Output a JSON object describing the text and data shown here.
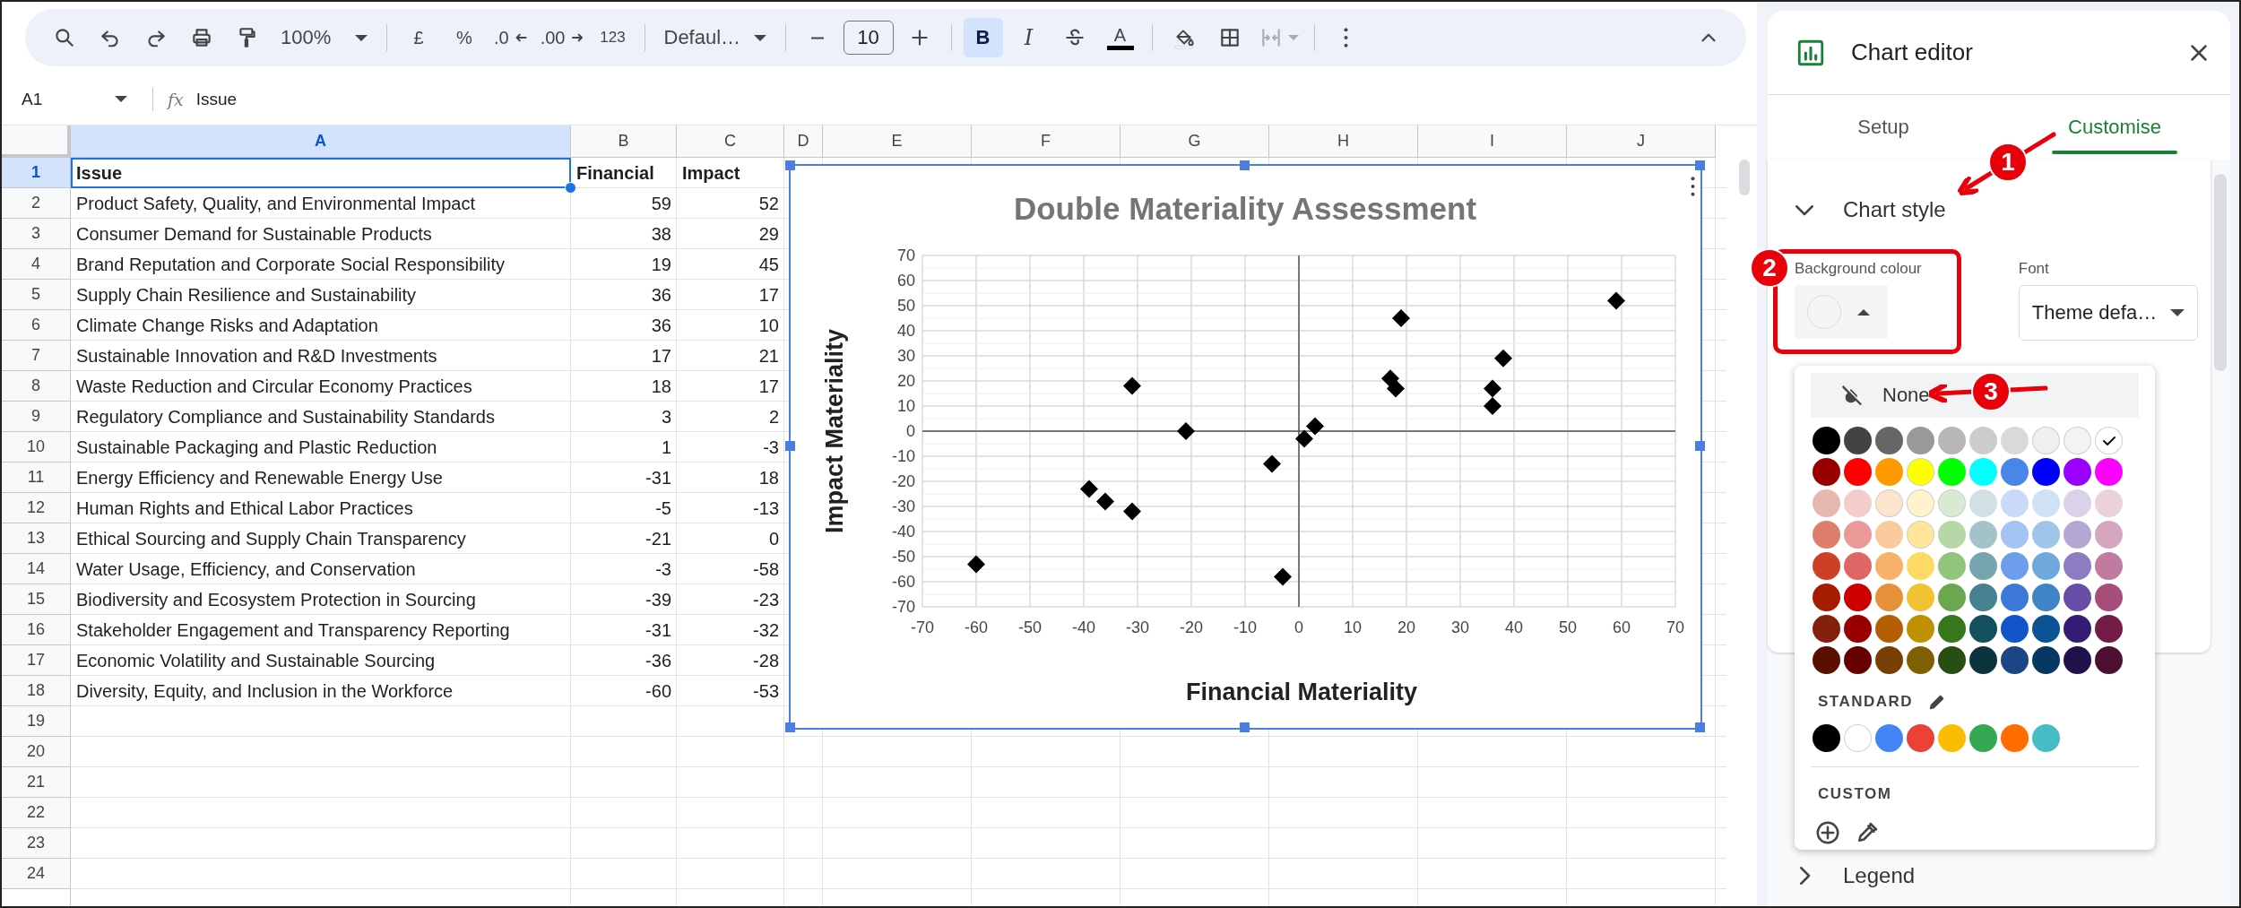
{
  "toolbar": {
    "zoom": "100%",
    "currency": "£",
    "percent": "%",
    "decrease_decimal": ".0",
    "increase_decimal": ".00",
    "number_format": "123",
    "font": "Defaul…",
    "font_size": "10",
    "bold": {
      "label": "B",
      "selected": true
    },
    "italic": {
      "label": "I",
      "selected": false
    },
    "text_colour": "A",
    "merge": {
      "disabled": true
    }
  },
  "formula_bar": {
    "cell": "A1",
    "fx": "fx",
    "value": "Issue"
  },
  "sheet": {
    "columns": [
      {
        "label": "A",
        "selected": true
      },
      {
        "label": "B",
        "selected": false
      },
      {
        "label": "C",
        "selected": false
      },
      {
        "label": "D",
        "selected": false
      },
      {
        "label": "E",
        "selected": false
      },
      {
        "label": "F",
        "selected": false
      },
      {
        "label": "G",
        "selected": false
      },
      {
        "label": "H",
        "selected": false
      },
      {
        "label": "I",
        "selected": false
      },
      {
        "label": "J",
        "selected": false
      }
    ],
    "rows": [
      {
        "number": "1",
        "selected": true,
        "bold": true,
        "cells": [
          "Issue",
          "Financial",
          "Impact"
        ]
      },
      {
        "number": "2",
        "selected": false,
        "bold": false,
        "cells": [
          "Product Safety, Quality, and Environmental Impact",
          "59",
          "52"
        ]
      },
      {
        "number": "3",
        "selected": false,
        "bold": false,
        "cells": [
          "Consumer Demand for Sustainable Products",
          "38",
          "29"
        ]
      },
      {
        "number": "4",
        "selected": false,
        "bold": false,
        "cells": [
          "Brand Reputation and Corporate Social Responsibility",
          "19",
          "45"
        ]
      },
      {
        "number": "5",
        "selected": false,
        "bold": false,
        "cells": [
          "Supply Chain Resilience and Sustainability",
          "36",
          "17"
        ]
      },
      {
        "number": "6",
        "selected": false,
        "bold": false,
        "cells": [
          "Climate Change Risks and Adaptation",
          "36",
          "10"
        ]
      },
      {
        "number": "7",
        "selected": false,
        "bold": false,
        "cells": [
          "Sustainable Innovation and R&D Investments",
          "17",
          "21"
        ]
      },
      {
        "number": "8",
        "selected": false,
        "bold": false,
        "cells": [
          "Waste Reduction and Circular Economy Practices",
          "18",
          "17"
        ]
      },
      {
        "number": "9",
        "selected": false,
        "bold": false,
        "cells": [
          "Regulatory Compliance and Sustainability Standards",
          "3",
          "2"
        ]
      },
      {
        "number": "10",
        "selected": false,
        "bold": false,
        "cells": [
          "Sustainable Packaging and Plastic Reduction",
          "1",
          "-3"
        ]
      },
      {
        "number": "11",
        "selected": false,
        "bold": false,
        "cells": [
          "Energy Efficiency and Renewable Energy Use",
          "-31",
          "18"
        ]
      },
      {
        "number": "12",
        "selected": false,
        "bold": false,
        "cells": [
          "Human Rights and Ethical Labor Practices",
          "-5",
          "-13"
        ]
      },
      {
        "number": "13",
        "selected": false,
        "bold": false,
        "cells": [
          "Ethical Sourcing and Supply Chain Transparency",
          "-21",
          "0"
        ]
      },
      {
        "number": "14",
        "selected": false,
        "bold": false,
        "cells": [
          "Water Usage, Efficiency, and Conservation",
          "-3",
          "-58"
        ]
      },
      {
        "number": "15",
        "selected": false,
        "bold": false,
        "cells": [
          "Biodiversity and Ecosystem Protection in Sourcing",
          "-39",
          "-23"
        ]
      },
      {
        "number": "16",
        "selected": false,
        "bold": false,
        "cells": [
          "Stakeholder Engagement and Transparency Reporting",
          "-31",
          "-32"
        ]
      },
      {
        "number": "17",
        "selected": false,
        "bold": false,
        "cells": [
          "Economic Volatility and Sustainable Sourcing",
          "-36",
          "-28"
        ]
      },
      {
        "number": "18",
        "selected": false,
        "bold": false,
        "cells": [
          "Diversity, Equity, and Inclusion in the Workforce",
          "-60",
          "-53"
        ]
      },
      {
        "number": "19",
        "selected": false
      },
      {
        "number": "20",
        "selected": false
      },
      {
        "number": "21",
        "selected": false
      },
      {
        "number": "22",
        "selected": false
      },
      {
        "number": "23",
        "selected": false
      },
      {
        "number": "24",
        "selected": false
      }
    ],
    "chart": {
      "chart_data": {
        "type": "scatter",
        "title": "Double Materiality Assessment",
        "xlabel": "Financial Materiality",
        "ylabel": "Impact Materiality",
        "x": [
          59,
          38,
          19,
          36,
          36,
          17,
          18,
          3,
          1,
          -31,
          -5,
          -21,
          -3,
          -39,
          -31,
          -36,
          -60
        ],
        "series": [
          {
            "color": "#000000",
            "values": [
              52,
              29,
              45,
              17,
              10,
              21,
              17,
              2,
              -3,
              18,
              -13,
              0,
              -58,
              -23,
              -32,
              -28,
              -53
            ]
          }
        ],
        "xlim": [
          -70,
          70
        ],
        "ylim": [
          -70,
          70
        ],
        "grid": true,
        "xticks": [
          -70,
          -60,
          -50,
          -40,
          -30,
          -20,
          -10,
          0,
          10,
          20,
          30,
          40,
          50,
          60,
          70
        ],
        "yticks": [
          -70,
          -60,
          -50,
          -40,
          -30,
          -20,
          -10,
          0,
          10,
          20,
          30,
          40,
          50,
          60,
          70
        ]
      }
    }
  },
  "chart_editor": {
    "title": "Chart editor",
    "tabs": [
      {
        "label": "Setup",
        "selected": false
      },
      {
        "label": "Customise",
        "selected": true
      }
    ],
    "sections": [
      {
        "title": "Chart style",
        "expanded": true
      },
      {
        "title": "Legend",
        "expanded": false
      }
    ],
    "background_colour": {
      "label": "Background colour"
    },
    "font": {
      "label": "Font",
      "value": "Theme defa…"
    },
    "colour_menu": {
      "none_label": "None",
      "palette": [
        [
          {
            "color": "#000000",
            "selected": false
          },
          {
            "color": "#434343",
            "selected": false
          },
          {
            "color": "#666666",
            "selected": false
          },
          {
            "color": "#999999",
            "selected": false
          },
          {
            "color": "#b7b7b7",
            "selected": false
          },
          {
            "color": "#cccccc",
            "selected": false
          },
          {
            "color": "#d9d9d9",
            "selected": false
          },
          {
            "color": "#efefef",
            "selected": false
          },
          {
            "color": "#f3f3f3",
            "selected": false
          },
          {
            "color": "#ffffff",
            "selected": true
          }
        ],
        [
          {
            "color": "#980000",
            "selected": false
          },
          {
            "color": "#ff0000",
            "selected": false
          },
          {
            "color": "#ff9900",
            "selected": false
          },
          {
            "color": "#ffff00",
            "selected": false
          },
          {
            "color": "#00ff00",
            "selected": false
          },
          {
            "color": "#00ffff",
            "selected": false
          },
          {
            "color": "#4a86e8",
            "selected": false
          },
          {
            "color": "#0000ff",
            "selected": false
          },
          {
            "color": "#9900ff",
            "selected": false
          },
          {
            "color": "#ff00ff",
            "selected": false
          }
        ],
        [
          {
            "color": "#e6b8af",
            "selected": false
          },
          {
            "color": "#f4cccc",
            "selected": false
          },
          {
            "color": "#fce5cd",
            "selected": false
          },
          {
            "color": "#fff2cc",
            "selected": false
          },
          {
            "color": "#d9ead3",
            "selected": false
          },
          {
            "color": "#d0e0e3",
            "selected": false
          },
          {
            "color": "#c9daf8",
            "selected": false
          },
          {
            "color": "#cfe2f3",
            "selected": false
          },
          {
            "color": "#d9d2e9",
            "selected": false
          },
          {
            "color": "#ead1dc",
            "selected": false
          }
        ],
        [
          {
            "color": "#dd7e6b",
            "selected": false
          },
          {
            "color": "#ea9999",
            "selected": false
          },
          {
            "color": "#f9cb9c",
            "selected": false
          },
          {
            "color": "#ffe599",
            "selected": false
          },
          {
            "color": "#b6d7a8",
            "selected": false
          },
          {
            "color": "#a2c4c9",
            "selected": false
          },
          {
            "color": "#a4c2f4",
            "selected": false
          },
          {
            "color": "#9fc5e8",
            "selected": false
          },
          {
            "color": "#b4a7d6",
            "selected": false
          },
          {
            "color": "#d5a6bd",
            "selected": false
          }
        ],
        [
          {
            "color": "#cc4125",
            "selected": false
          },
          {
            "color": "#e06666",
            "selected": false
          },
          {
            "color": "#f6b26b",
            "selected": false
          },
          {
            "color": "#ffd966",
            "selected": false
          },
          {
            "color": "#93c47d",
            "selected": false
          },
          {
            "color": "#76a5af",
            "selected": false
          },
          {
            "color": "#6d9eeb",
            "selected": false
          },
          {
            "color": "#6fa8dc",
            "selected": false
          },
          {
            "color": "#8e7cc3",
            "selected": false
          },
          {
            "color": "#c27ba0",
            "selected": false
          }
        ],
        [
          {
            "color": "#a61c00",
            "selected": false
          },
          {
            "color": "#cc0000",
            "selected": false
          },
          {
            "color": "#e69138",
            "selected": false
          },
          {
            "color": "#f1c232",
            "selected": false
          },
          {
            "color": "#6aa84f",
            "selected": false
          },
          {
            "color": "#45818e",
            "selected": false
          },
          {
            "color": "#3c78d8",
            "selected": false
          },
          {
            "color": "#3d85c6",
            "selected": false
          },
          {
            "color": "#674ea7",
            "selected": false
          },
          {
            "color": "#a64d79",
            "selected": false
          }
        ],
        [
          {
            "color": "#85200c",
            "selected": false
          },
          {
            "color": "#990000",
            "selected": false
          },
          {
            "color": "#b45f06",
            "selected": false
          },
          {
            "color": "#bf9000",
            "selected": false
          },
          {
            "color": "#38761d",
            "selected": false
          },
          {
            "color": "#134f5c",
            "selected": false
          },
          {
            "color": "#1155cc",
            "selected": false
          },
          {
            "color": "#0b5394",
            "selected": false
          },
          {
            "color": "#351c75",
            "selected": false
          },
          {
            "color": "#741b47",
            "selected": false
          }
        ],
        [
          {
            "color": "#5b0f00",
            "selected": false
          },
          {
            "color": "#660000",
            "selected": false
          },
          {
            "color": "#783f04",
            "selected": false
          },
          {
            "color": "#7f6000",
            "selected": false
          },
          {
            "color": "#274e13",
            "selected": false
          },
          {
            "color": "#0c343d",
            "selected": false
          },
          {
            "color": "#1c4587",
            "selected": false
          },
          {
            "color": "#073763",
            "selected": false
          },
          {
            "color": "#20124d",
            "selected": false
          },
          {
            "color": "#4c1130",
            "selected": false
          }
        ]
      ],
      "standard_label": "STANDARD",
      "standard": [
        {
          "color": "#000000",
          "selected": false
        },
        {
          "color": "#ffffff",
          "selected": false
        },
        {
          "color": "#4285f4",
          "selected": false
        },
        {
          "color": "#ea4335",
          "selected": false
        },
        {
          "color": "#fbbc04",
          "selected": false
        },
        {
          "color": "#34a853",
          "selected": false
        },
        {
          "color": "#ff6d01",
          "selected": false
        },
        {
          "color": "#46bdc6",
          "selected": false
        }
      ],
      "custom_label": "CUSTOM"
    }
  },
  "annotations": [
    {
      "label": "1"
    },
    {
      "label": "2"
    },
    {
      "label": "3"
    }
  ]
}
